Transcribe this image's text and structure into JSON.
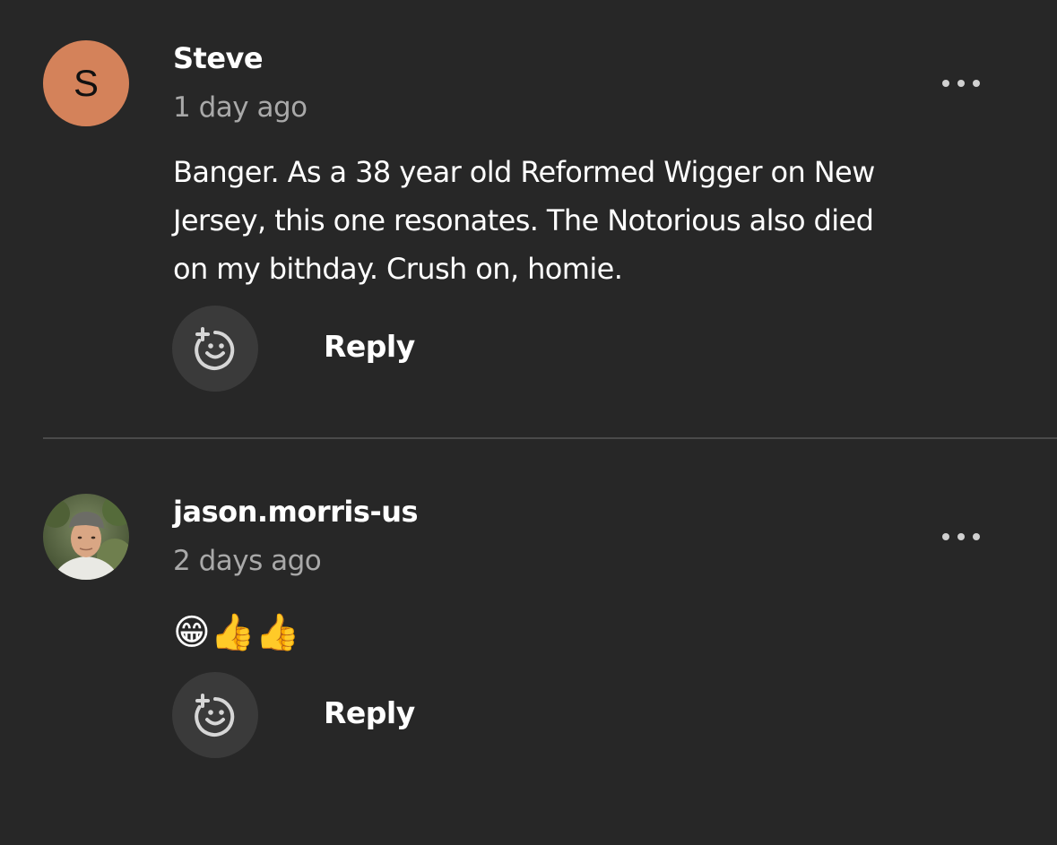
{
  "comments": [
    {
      "username": "Steve",
      "avatar_letter": "S",
      "timestamp": "1 day ago",
      "body_lines": [
        "Banger.  As a 38 year old Reformed Wigger on New",
        "Jersey, this one resonates.  The Notorious also died",
        "on my bithday.  Crush on, homie."
      ],
      "reply_label": "Reply"
    },
    {
      "username": "jason.morris-us",
      "timestamp": "2 days ago",
      "body": "😁👍👍",
      "reply_label": "Reply"
    }
  ],
  "colors": {
    "background": "#272727",
    "avatar_s": "#d4825a",
    "reaction_button": "#3a3a3a",
    "timestamp": "#a9a9a9"
  },
  "icons": {
    "more": "more-horizontal-icon",
    "add_reaction": "add-reaction-icon"
  }
}
